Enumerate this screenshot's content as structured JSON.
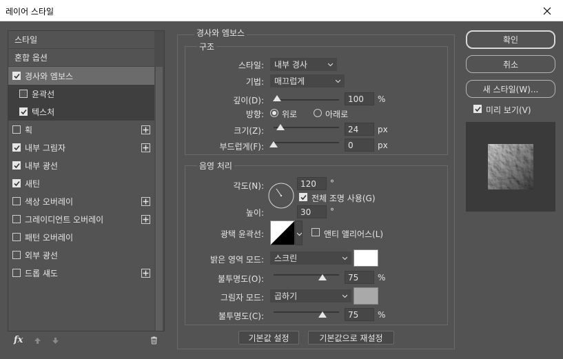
{
  "window": {
    "title": "레이어 스타일"
  },
  "left": {
    "items": [
      {
        "label": "스타일",
        "kind": "head"
      },
      {
        "label": "혼합 옵션",
        "kind": "head"
      },
      {
        "label": "경사와 엠보스",
        "checked": true,
        "kind": "sel"
      },
      {
        "label": "윤곽선",
        "checked": false,
        "kind": "sub"
      },
      {
        "label": "텍스처",
        "checked": true,
        "kind": "sub"
      },
      {
        "label": "획",
        "checked": false,
        "plus": true
      },
      {
        "label": "내부 그림자",
        "checked": true,
        "plus": true
      },
      {
        "label": "내부 광선",
        "checked": true
      },
      {
        "label": "새틴",
        "checked": true
      },
      {
        "label": "색상 오버레이",
        "checked": false,
        "plus": true
      },
      {
        "label": "그레이디언트 오버레이",
        "checked": false,
        "plus": true
      },
      {
        "label": "패턴 오버레이",
        "checked": false
      },
      {
        "label": "외부 광선",
        "checked": false
      },
      {
        "label": "드롭 섀도",
        "checked": false,
        "plus": true
      }
    ],
    "fx_label": "fx"
  },
  "bevel": {
    "title": "경사와 엠보스",
    "structure": {
      "title": "구조",
      "style_label": "스타일:",
      "style_value": "내부 경사",
      "technique_label": "기법:",
      "technique_value": "매끄럽게",
      "depth_label": "깊이(D):",
      "depth_value": "100",
      "depth_unit": "%",
      "depth_level": 0.05,
      "direction_label": "방향:",
      "direction_up": "위로",
      "direction_down": "아래로",
      "size_label": "크기(Z):",
      "size_value": "24",
      "size_unit": "px",
      "size_level": 0.1,
      "soften_label": "부드럽게(F):",
      "soften_value": "0",
      "soften_unit": "px",
      "soften_level": 0.0
    },
    "shading": {
      "title": "음영 처리",
      "angle_label": "각도(N):",
      "angle_value": "120",
      "angle_unit": "°",
      "global_light_label": "전체 조명 사용(G)",
      "altitude_label": "높이:",
      "altitude_value": "30",
      "altitude_unit": "°",
      "gloss_label": "광택 윤곽선:",
      "antialias_label": "앤티 앨리어스(L)",
      "highlight_mode_label": "밝은 영역 모드:",
      "highlight_mode_value": "스크린",
      "highlight_color": "#ffffff",
      "highlight_opacity_label": "불투명도(O):",
      "highlight_opacity_value": "75",
      "highlight_opacity_unit": "%",
      "highlight_opacity_level": 0.75,
      "shadow_mode_label": "그림자 모드:",
      "shadow_mode_value": "곱하기",
      "shadow_color": "#a9a9a9",
      "shadow_opacity_label": "불투명도(C):",
      "shadow_opacity_value": "75",
      "shadow_opacity_unit": "%",
      "shadow_opacity_level": 0.75
    },
    "make_default": "기본값 설정",
    "reset_default": "기본값으로 재설정"
  },
  "right": {
    "ok": "확인",
    "cancel": "취소",
    "new_style": "새 스타일(W)...",
    "preview_label": "미리 보기(V)"
  }
}
